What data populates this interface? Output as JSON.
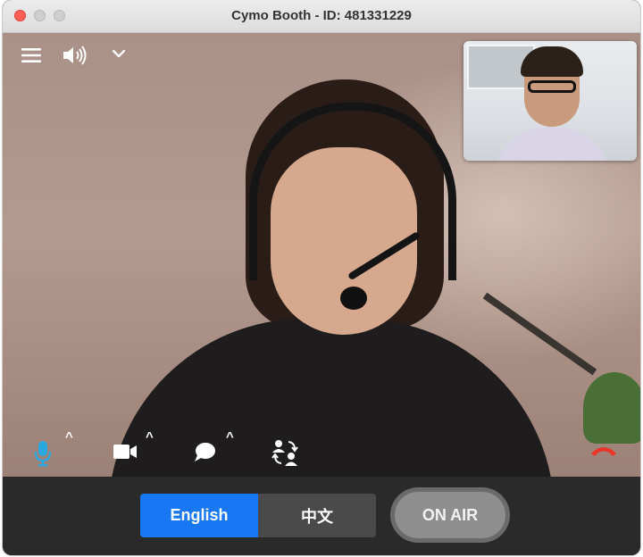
{
  "window": {
    "title": "Cymo Booth - ID: 481331229"
  },
  "colors": {
    "accent": "#1877f2",
    "mic_active": "#29a8e0",
    "hangup": "#e8352b",
    "on_air_bg": "#8e8e8e"
  },
  "top_controls": {
    "menu_icon": "hamburger-menu-icon",
    "volume_icon": "speaker-volume-icon",
    "dropdown_icon": "chevron-down-icon"
  },
  "bottom_controls": {
    "mic_icon": "microphone-icon",
    "camera_icon": "video-camera-icon",
    "chat_icon": "chat-bubble-icon",
    "participants_icon": "participants-swap-icon",
    "hangup_icon": "hang-up-phone-icon",
    "caret": "^"
  },
  "language_toggle": {
    "options": [
      "English",
      "中文"
    ],
    "selected": "English"
  },
  "on_air": {
    "label": "ON AIR"
  }
}
